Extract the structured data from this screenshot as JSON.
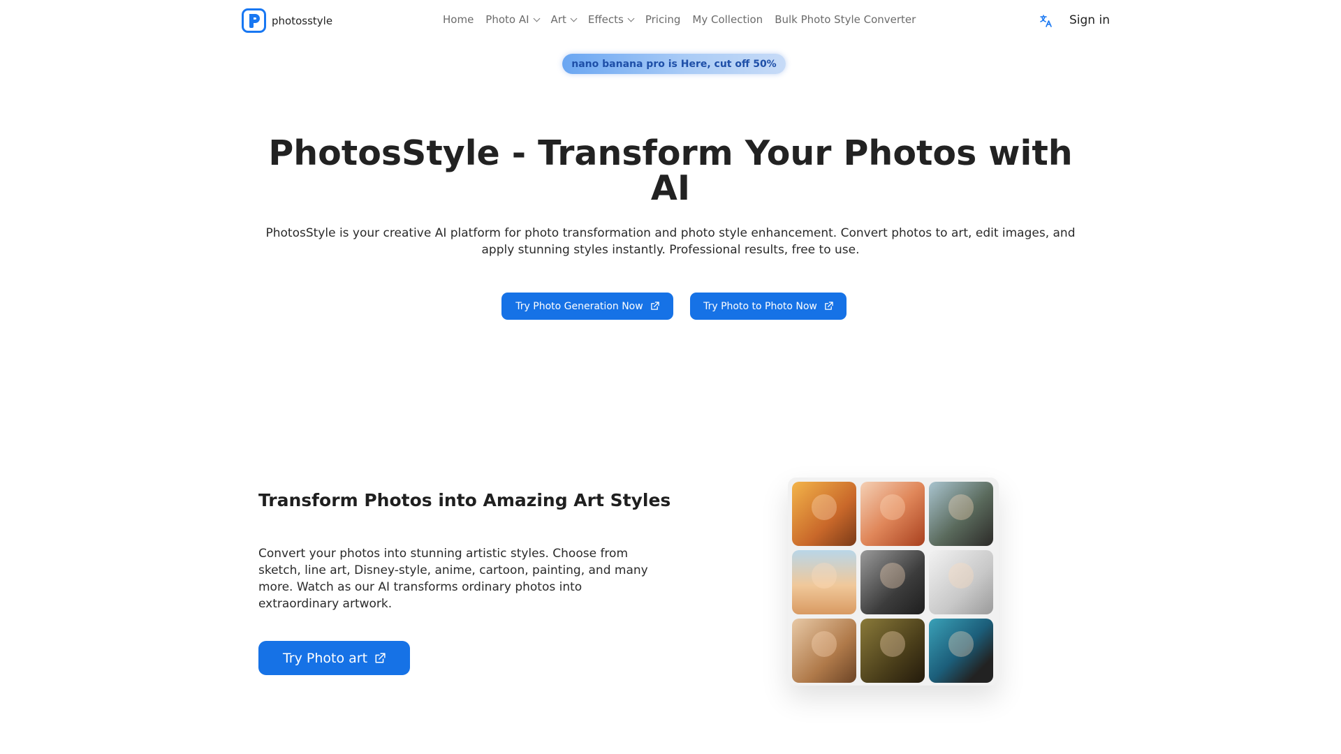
{
  "header": {
    "logo_text": "photosstyle",
    "nav": [
      {
        "label": "Home",
        "dropdown": false
      },
      {
        "label": "Photo AI",
        "dropdown": true
      },
      {
        "label": "Art",
        "dropdown": true
      },
      {
        "label": "Effects",
        "dropdown": true
      },
      {
        "label": "Pricing",
        "dropdown": false
      },
      {
        "label": "My Collection",
        "dropdown": false
      },
      {
        "label": "Bulk Photo Style Converter",
        "dropdown": false
      }
    ],
    "language_icon": "translate-icon",
    "signin_label": "Sign in"
  },
  "promo": {
    "text": "nano banana pro is Here, cut off 50%"
  },
  "hero": {
    "title": "PhotosStyle - Transform Your Photos with AI",
    "description": "PhotosStyle is your creative AI platform for photo transformation and photo style enhancement. Convert photos to art, edit images, and apply stunning styles instantly. Professional results, free to use.",
    "primary_button": "Try Photo Generation Now",
    "secondary_button": "Try Photo to Photo Now"
  },
  "section": {
    "title": "Transform Photos into Amazing Art Styles",
    "description": "Convert your photos into stunning artistic styles. Choose from sketch, line art, Disney-style, anime, cartoon, painting, and many more. Watch as our AI transforms ordinary photos into extraordinary artwork.",
    "button": "Try Photo art"
  },
  "colors": {
    "accent": "#1672e6",
    "text": "#222222",
    "nav_text": "#6b6b6b"
  }
}
